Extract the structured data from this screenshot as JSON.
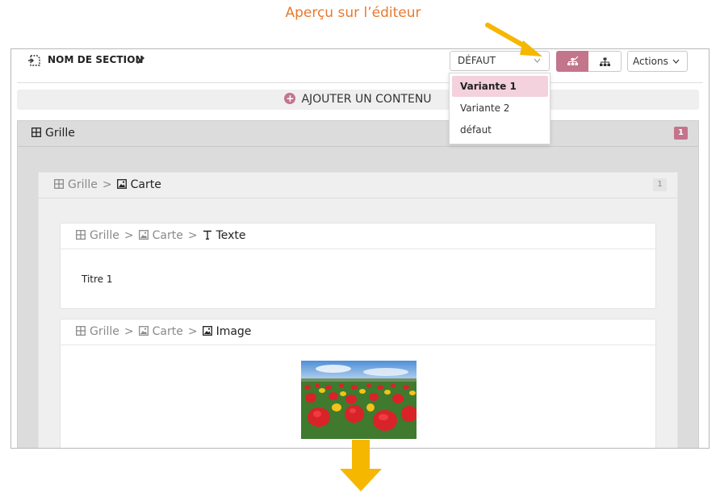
{
  "caption": "Aperçu sur l’éditeur",
  "toolbar": {
    "section_title": "NOM DE SECTION",
    "variant_select_value": "DÉFAUT",
    "actions_label": "Actions",
    "accent_color": "#c3758c"
  },
  "add_content_label": "AJOUTER UN CONTENU",
  "grid_panel": {
    "label": "Grille",
    "count": "1"
  },
  "card_panel": {
    "crumb_grid": "Grille",
    "label": "Carte",
    "count": "1"
  },
  "text_card": {
    "crumb_grid": "Grille",
    "crumb_card": "Carte",
    "label": "Texte",
    "content": "Titre 1"
  },
  "image_card": {
    "crumb_grid": "Grille",
    "crumb_card": "Carte",
    "label": "Image"
  },
  "dropdown": {
    "options": [
      "Variante 1",
      "Variante 2",
      "défaut"
    ],
    "selected": "Variante 1"
  },
  "icons": {
    "section": "section-icon",
    "edit": "pencil-icon",
    "grid": "grid-icon",
    "image": "image-icon",
    "text": "text-icon",
    "plus": "plus-circle-icon",
    "hierarchy": "hierarchy-icon"
  }
}
